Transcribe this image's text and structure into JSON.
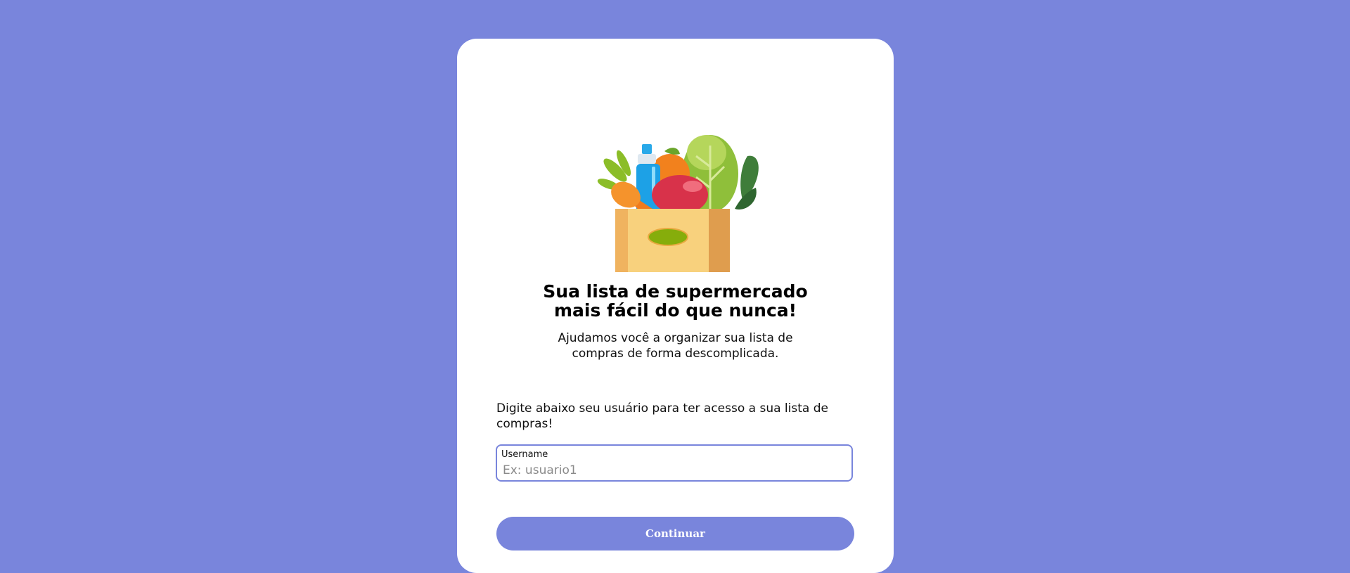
{
  "hero": {
    "headline_line1": "Sua lista de supermercado",
    "headline_line2": "mais fácil do que nunca!",
    "subhead_line1": "Ajudamos você a organizar sua lista de",
    "subhead_line2": "compras de forma descomplicada."
  },
  "form": {
    "instruction": "Digite abaixo seu usuário para ter acesso a sua lista de compras!",
    "username_label": "Username",
    "username_placeholder": "Ex: usuario1",
    "username_value": "",
    "continue_label": "Continuar"
  },
  "icons": {
    "illustration": "grocery-bag-icon"
  },
  "colors": {
    "background": "#7985dc",
    "card": "#ffffff",
    "accent": "#7985dc"
  }
}
